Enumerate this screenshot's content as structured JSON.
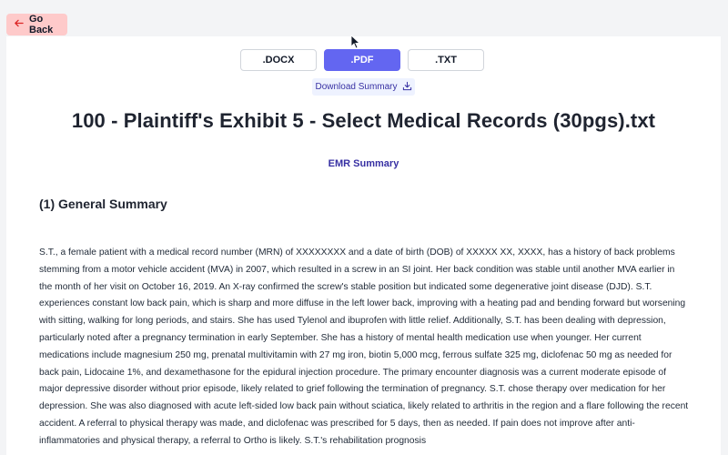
{
  "back": {
    "label": "Go Back"
  },
  "formats": [
    {
      "label": ".DOCX",
      "active": false
    },
    {
      "label": ".PDF",
      "active": true
    },
    {
      "label": ".TXT",
      "active": false
    }
  ],
  "download": {
    "label": "Download Summary"
  },
  "document": {
    "title": "100 - Plaintiff's Exhibit 5 - Select Medical Records (30pgs).txt",
    "emr_link": "EMR Summary",
    "section_title": "(1) General Summary",
    "paragraph": "S.T., a female patient with a medical record number (MRN) of XXXXXXXX and a date of birth (DOB) of XXXXX XX, XXXX, has a history of back problems stemming from a motor vehicle accident (MVA) in 2007, which resulted in a screw in an SI joint. Her back condition was stable until another MVA earlier in the month of her visit on October 16, 2019. An X-ray confirmed the screw's stable position but indicated some degenerative joint disease (DJD). S.T. experiences constant low back pain, which is sharp and more diffuse in the left lower back, improving with a heating pad and bending forward but worsening with sitting, walking for long periods, and stairs. She has used Tylenol and ibuprofen with little relief. Additionally, S.T. has been dealing with depression, particularly noted after a pregnancy termination in early September. She has a history of mental health medication use when younger. Her current medications include magnesium 250 mg, prenatal multivitamin with 27 mg iron, biotin 5,000 mcg, ferrous sulfate 325 mg, diclofenac 50 mg as needed for back pain, Lidocaine 1%, and dexamethasone for the epidural injection procedure. The primary encounter diagnosis was a current moderate episode of major depressive disorder without prior episode, likely related to grief following the termination of pregnancy. S.T. chose therapy over medication for her depression. She was also diagnosed with acute left-sided low back pain without sciatica, likely related to arthritis in the region and a flare following the recent accident. A referral to physical therapy was made, and diclofenac was prescribed for 5 days, then as needed. If pain does not improve after anti-inflammatories and physical therapy, a referral to Ortho is likely. S.T.'s rehabilitation prognosis"
  },
  "icons": {
    "back": "arrow-left-icon",
    "download": "download-icon",
    "cursor": "mouse-cursor-icon"
  }
}
